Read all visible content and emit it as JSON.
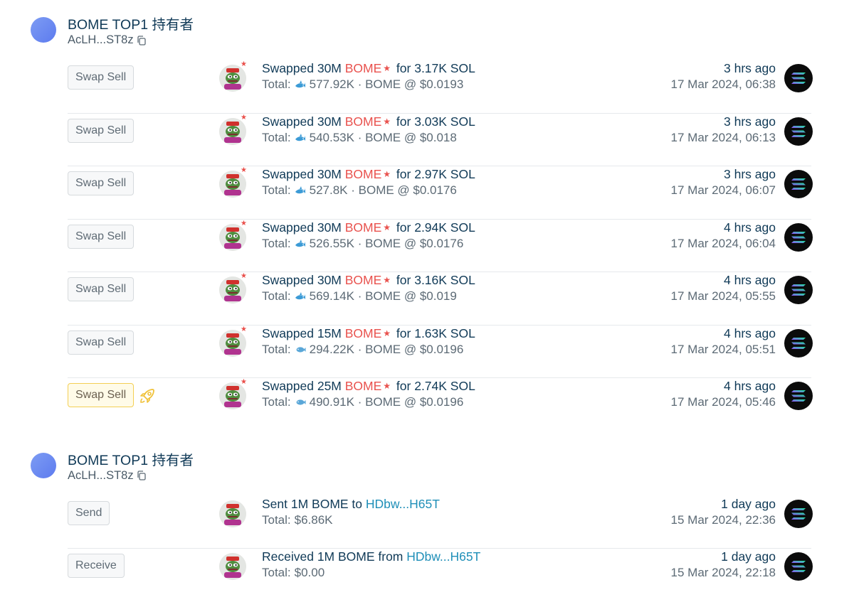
{
  "groups": [
    {
      "wallet_name": "BOME TOP1 持有者",
      "wallet_address": "AcLH...ST8z",
      "rows": [
        {
          "type": "Swap Sell",
          "highlight": false,
          "verb": "Swapped 30M ",
          "token": "BOME",
          "rest": " for 3.17K SOL",
          "total_prefix": "Total:",
          "size_icon": "shark-icon",
          "total_value": "577.92K · BOME @ $0.0193",
          "ago": "3 hrs ago",
          "date": "17 Mar 2024, 06:38"
        },
        {
          "type": "Swap Sell",
          "highlight": false,
          "verb": "Swapped 30M ",
          "token": "BOME",
          "rest": " for 3.03K SOL",
          "total_prefix": "Total:",
          "size_icon": "shark-icon",
          "total_value": "540.53K · BOME @ $0.018",
          "ago": "3 hrs ago",
          "date": "17 Mar 2024, 06:13"
        },
        {
          "type": "Swap Sell",
          "highlight": false,
          "verb": "Swapped 30M ",
          "token": "BOME",
          "rest": " for 2.97K SOL",
          "total_prefix": "Total:",
          "size_icon": "shark-icon",
          "total_value": "527.8K · BOME @ $0.0176",
          "ago": "3 hrs ago",
          "date": "17 Mar 2024, 06:07"
        },
        {
          "type": "Swap Sell",
          "highlight": false,
          "verb": "Swapped 30M ",
          "token": "BOME",
          "rest": " for 2.94K SOL",
          "total_prefix": "Total:",
          "size_icon": "shark-icon",
          "total_value": "526.55K · BOME @ $0.0176",
          "ago": "4 hrs ago",
          "date": "17 Mar 2024, 06:04"
        },
        {
          "type": "Swap Sell",
          "highlight": false,
          "verb": "Swapped 30M ",
          "token": "BOME",
          "rest": " for 3.16K SOL",
          "total_prefix": "Total:",
          "size_icon": "shark-icon",
          "total_value": "569.14K · BOME @ $0.019",
          "ago": "4 hrs ago",
          "date": "17 Mar 2024, 05:55"
        },
        {
          "type": "Swap Sell",
          "highlight": false,
          "verb": "Swapped 15M ",
          "token": "BOME",
          "rest": " for 1.63K SOL",
          "total_prefix": "Total:",
          "size_icon": "fish-icon",
          "total_value": "294.22K · BOME @ $0.0196",
          "ago": "4 hrs ago",
          "date": "17 Mar 2024, 05:51"
        },
        {
          "type": "Swap Sell",
          "highlight": true,
          "verb": "Swapped 25M ",
          "token": "BOME",
          "rest": " for 2.74K SOL",
          "total_prefix": "Total:",
          "size_icon": "fish-icon",
          "total_value": "490.91K · BOME @ $0.0196",
          "ago": "4 hrs ago",
          "date": "17 Mar 2024, 05:46"
        }
      ]
    },
    {
      "wallet_name": "BOME TOP1 持有者",
      "wallet_address": "AcLH...ST8z",
      "rows": [
        {
          "type": "Send",
          "verb": "Sent 1M BOME to ",
          "link": "HDbw...H65T",
          "total_prefix": "Total:",
          "total_value": "$6.86K",
          "ago": "1 day ago",
          "date": "15 Mar 2024, 22:36"
        },
        {
          "type": "Receive",
          "verb": "Received 1M BOME from ",
          "link": "HDbw...H65T",
          "total_prefix": "Total:",
          "total_value": "$0.00",
          "ago": "1 day ago",
          "date": "15 Mar 2024, 22:18"
        }
      ]
    }
  ],
  "icons": {
    "copy": "copy-icon",
    "rocket": "rocket-icon",
    "chain": "solana-icon",
    "token_avatar": "pepe-token-avatar",
    "shark": "shark-icon",
    "fish": "fish-icon"
  },
  "colors": {
    "token_accent": "#e9524e",
    "link": "#1f8fb8",
    "highlight_border": "#f3cf54"
  }
}
